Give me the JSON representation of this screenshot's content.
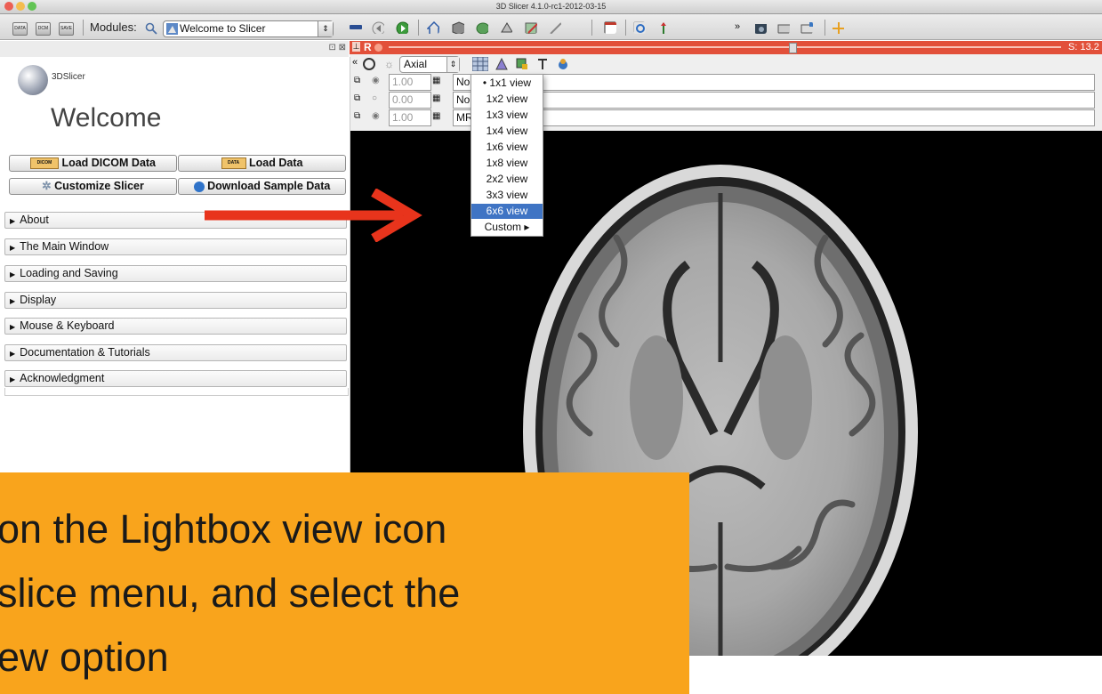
{
  "window": {
    "title": "3D Slicer 4.1.0-rc1-2012-03-15"
  },
  "toolbar": {
    "data_icon": "DATA",
    "dcm_icon": "DCM",
    "save_icon": "SAVE",
    "modules_label": "Modules:",
    "module_selected": "Welcome to Slicer",
    "icons": [
      "search-icon",
      "module-icon",
      "layout-icon",
      "back-icon",
      "forward-icon",
      "home-icon",
      "3d-cube-icon",
      "brain-icon",
      "models-icon",
      "editor-icon",
      "ruler-icon",
      "layout-grid-icon",
      "crosshair-icon",
      "mouse-mode-icon",
      "camera-icon",
      "screenshot-icon",
      "scene-view-icon",
      "fiducial-icon"
    ]
  },
  "slice": {
    "view_label": "R",
    "offset": "S: 13.2",
    "orientation": "Axial",
    "rows": [
      {
        "opacity": "1.00",
        "volume": "No"
      },
      {
        "opacity": "0.00",
        "volume": "No"
      },
      {
        "opacity": "1.00",
        "volume": "MR"
      }
    ],
    "layout_menu": [
      "• 1x1 view",
      "1x2 view",
      "1x3 view",
      "1x4 view",
      "1x6 view",
      "1x8 view",
      "2x2 view",
      "3x3 view",
      "6x6 view",
      "Custom ▸"
    ],
    "selected_layout": "6x6 view"
  },
  "left_panel": {
    "logo_text": "3DSlicer",
    "welcome": "Welcome",
    "buttons": {
      "load_dicom": "Load DICOM Data",
      "load_data": "Load Data",
      "customize": "Customize Slicer",
      "download": "Download Sample Data",
      "dicom_icon_text": "DICOM",
      "data_icon_text": "DATA"
    },
    "sections": [
      "About",
      "The Main Window",
      "Loading and Saving",
      "Display",
      "Mouse & Keyboard",
      "Documentation & Tutorials",
      "Acknowledgment"
    ]
  },
  "callout": {
    "lines": [
      "on the Lightbox view icon",
      "slice menu, and select the",
      "ew option"
    ]
  },
  "colors": {
    "slice_red": "#e2503a",
    "callout": "#f9a41c",
    "arrow": "#e8341c",
    "menu_highlight": "#3f74c4"
  }
}
